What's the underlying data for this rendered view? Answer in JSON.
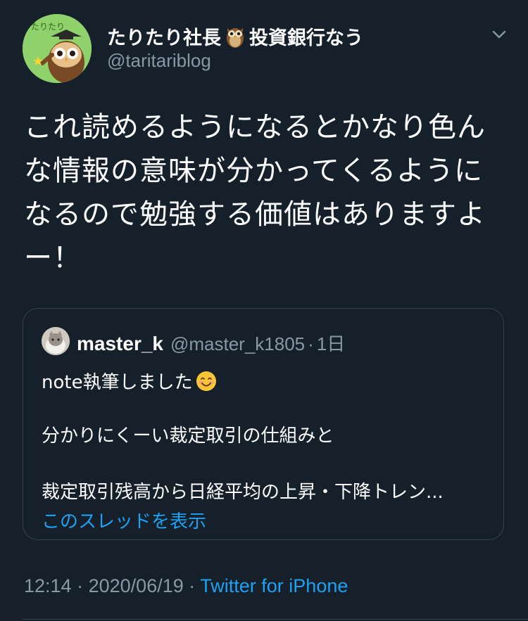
{
  "tweet": {
    "avatar_label": "たりたり",
    "display_name_part1": "たりたり社長",
    "display_name_icon": "owl-emoji",
    "display_name_part2": "投資銀行なう",
    "handle": "@taritariblog",
    "menu_icon": "chevron-down-icon",
    "text": "これ読めるようになるとかなり色んな情報の意味が分かってくるようになるので勉強する価値はありますよー！",
    "time": "12:14",
    "date": "2020/06/19",
    "separator": "·",
    "source": "Twitter for iPhone"
  },
  "quote": {
    "name": "master_k",
    "handle": "@master_k1805",
    "separator": "·",
    "time": "1日",
    "line1": "note執筆しました",
    "line1_icon": "smiling-face-emoji",
    "line2": "分かりにくーい裁定取引の仕組みと",
    "line3": "裁定取引残高から日経平均の上昇・下降トレン...",
    "show_thread": "このスレッドを表示"
  },
  "colors": {
    "background": "#15202b",
    "text_primary": "#ffffff",
    "text_secondary": "#8899a6",
    "link": "#1da1f2",
    "border": "#38444d"
  }
}
